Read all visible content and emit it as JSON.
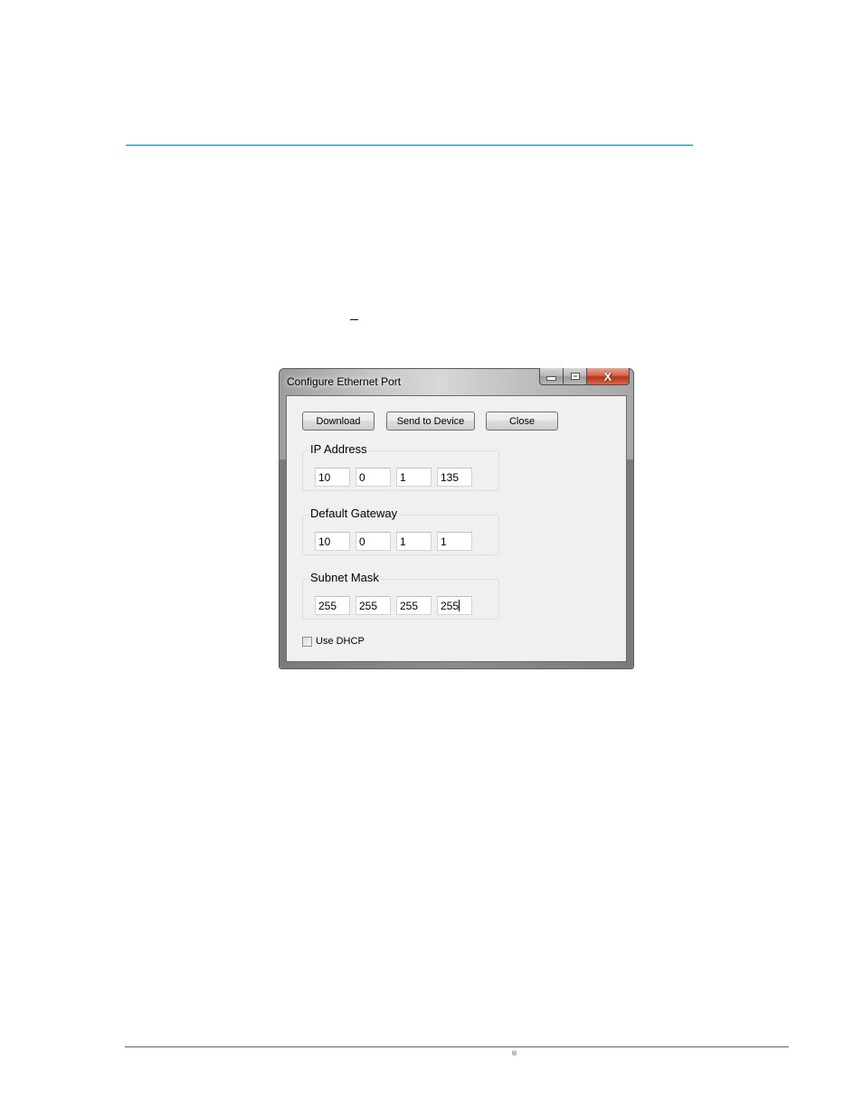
{
  "page": {
    "dash_mark": "–",
    "registered_mark": "®",
    "rule_color": "#1a7bb8"
  },
  "window": {
    "title": "Configure Ethernet Port",
    "caption_buttons": {
      "minimize_icon": "minimize-icon",
      "maximize_icon": "maximize-icon",
      "close_icon": "close-icon",
      "close_glyph": "X"
    },
    "toolbar": {
      "download_label": "Download",
      "send_label": "Send to Device",
      "close_label": "Close"
    },
    "groups": {
      "ip": {
        "label": "IP Address",
        "octets": [
          "10",
          "0",
          "1",
          "135"
        ]
      },
      "gateway": {
        "label": "Default Gateway",
        "octets": [
          "10",
          "0",
          "1",
          "1"
        ]
      },
      "mask": {
        "label": "Subnet Mask",
        "octets": [
          "255",
          "255",
          "255",
          "255"
        ]
      }
    },
    "dhcp": {
      "label": "Use DHCP",
      "checked": false
    }
  }
}
